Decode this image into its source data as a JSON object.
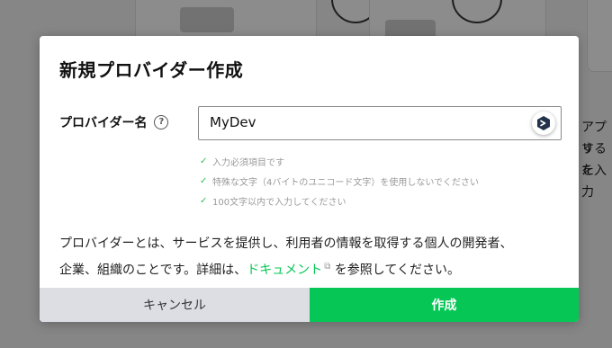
{
  "background": {
    "side_text": [
      "アプリ",
      "するた",
      "を入力"
    ]
  },
  "dialog": {
    "title": "新規プロバイダー作成",
    "provider_name": {
      "label": "プロバイダー名",
      "help_icon": "question-circle-icon",
      "value": "MyDev"
    },
    "rules": [
      "入力必須項目です",
      "特殊な文字（4バイトのユニコード文字）を使用しないでください",
      "100文字以内で入力してください"
    ],
    "description": {
      "line1": "プロバイダーとは、サービスを提供し、利用者の情報を取得する個人の開発者、",
      "line2_prefix": "企業、組織のことです。詳細は、",
      "link_text": "ドキュメント",
      "line2_suffix": "を参照してください。"
    },
    "buttons": {
      "cancel": "キャンセル",
      "create": "作成"
    }
  },
  "colors": {
    "brand_green": "#06c755",
    "cancel_bg": "#dcdee4"
  }
}
